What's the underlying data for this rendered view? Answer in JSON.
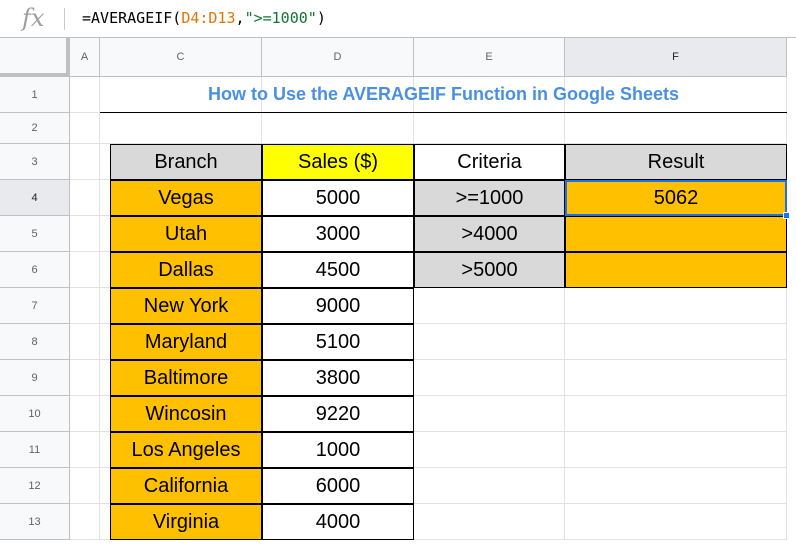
{
  "formula_bar": {
    "fx_label": "fx",
    "prefix": "=AVERAGEIF(",
    "range_ref": "D4:D13",
    "comma": ",",
    "criteria_string": "\">=1000\"",
    "suffix": ")"
  },
  "column_headers": [
    "A",
    "C",
    "D",
    "E",
    "F"
  ],
  "row_headers": [
    "1",
    "2",
    "3",
    "4",
    "5",
    "6",
    "7",
    "8",
    "9",
    "10",
    "11",
    "12",
    "13"
  ],
  "sheet_title": "How to Use the AVERAGEIF Function in Google Sheets",
  "table": {
    "branch_header": "Branch",
    "sales_header": "Sales ($)",
    "rows": [
      {
        "branch": "Vegas",
        "sales": "5000"
      },
      {
        "branch": "Utah",
        "sales": "3000"
      },
      {
        "branch": "Dallas",
        "sales": "4500"
      },
      {
        "branch": "New York",
        "sales": "9000"
      },
      {
        "branch": "Maryland",
        "sales": "5100"
      },
      {
        "branch": "Baltimore",
        "sales": "3800"
      },
      {
        "branch": "Wincosin",
        "sales": "9220"
      },
      {
        "branch": "Los Angeles",
        "sales": "1000"
      },
      {
        "branch": "California",
        "sales": "6000"
      },
      {
        "branch": "Virginia",
        "sales": "4000"
      }
    ]
  },
  "criteria_table": {
    "criteria_header": "Criteria",
    "result_header": "Result",
    "rows": [
      {
        "criteria": ">=1000",
        "result": "5062"
      },
      {
        "criteria": ">4000",
        "result": ""
      },
      {
        "criteria": ">5000",
        "result": ""
      }
    ]
  },
  "colors": {
    "branch_fill": "#ffc000",
    "sales_header_fill": "#ffff00",
    "criteria_fill": "#d9d9d9",
    "result_fill": "#ffc000",
    "title_color": "#4a90e2",
    "selection_color": "#1a73e8"
  },
  "active_cell": "F4"
}
